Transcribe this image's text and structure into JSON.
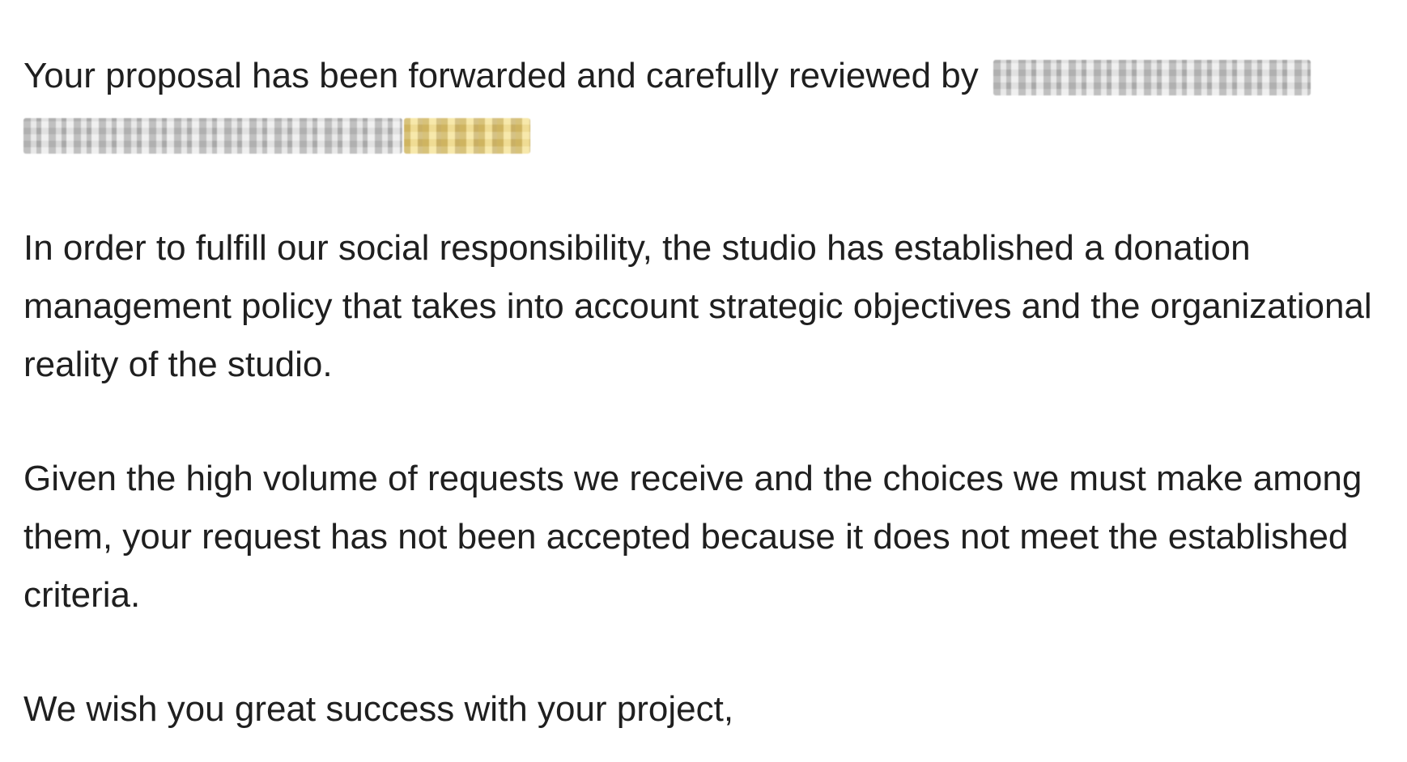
{
  "message": {
    "p1_text": "Your proposal has been forwarded and carefully reviewed by",
    "p2": "In order to fulfill our social responsibility, the studio has established a donation management policy that takes into account strategic objectives and the organizational reality of the studio.",
    "p3": "Given the high volume of requests we receive and the choices we must make among them, your request has not been accepted because it does not meet the established criteria.",
    "p4": "We wish you great success with your project,"
  }
}
